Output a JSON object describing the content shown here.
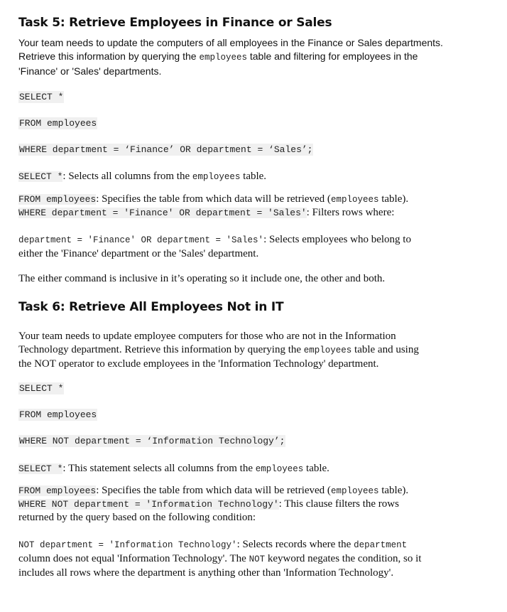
{
  "task5": {
    "heading": "Task 5: Retrieve Employees in Finance or Sales",
    "intro": {
      "p1": "Your team needs to update the computers of all employees in the Finance or Sales departments.",
      "p2a": "Retrieve this information by querying the ",
      "p2code": "employees",
      "p2b": " table and filtering for employees in the",
      "p3": "'Finance' or 'Sales' departments."
    },
    "code": {
      "line1": "SELECT *",
      "line2": "FROM employees",
      "line3": "WHERE department = ‘Finance’ OR department = ‘Sales’;"
    },
    "explain": {
      "select_code": "SELECT *",
      "select_text": ": Selects all columns from the ",
      "select_tbl": "employees",
      "select_end": " table.",
      "from_code": "FROM employees",
      "from_text": ": Specifies the table from which data will be retrieved (",
      "from_tbl": "employees",
      "from_end": " table).",
      "where_code": "WHERE department = 'Finance' OR department = 'Sales'",
      "where_text": ": Filters rows where:",
      "cond_code": "department = 'Finance' OR department = 'Sales'",
      "cond_text": ": Selects employees who belong to",
      "cond_text2": "either the 'Finance' department or the 'Sales' department."
    },
    "note": "The either command is inclusive in it’s operating so it include one, the other and both."
  },
  "task6": {
    "heading": "Task 6: Retrieve All Employees Not in IT",
    "intro": {
      "p1": "Your team needs to update employee computers for those who are not in the Information",
      "p2a": "Technology department. Retrieve this information by querying the ",
      "p2code": "employees",
      "p2b": " table and using",
      "p3": "the NOT operator to exclude employees in the 'Information Technology' department."
    },
    "code": {
      "line1": "SELECT *",
      "line2": "FROM employees",
      "line3": "WHERE NOT department = ‘Information Technology’;"
    },
    "explain": {
      "select_code": "SELECT *",
      "select_text": ": This statement selects all columns from the ",
      "select_tbl": "employees",
      "select_end": " table.",
      "from_code": "FROM employees",
      "from_text": ": Specifies the table from which data will be retrieved (",
      "from_tbl": "employees",
      "from_end": " table).",
      "where_code": "WHERE NOT department = 'Information Technology'",
      "where_text": ": This clause filters the rows",
      "where_text2": "returned by the query based on the following condition:",
      "cond_code": "NOT department = 'Information Technology'",
      "cond_text": ": Selects records where the ",
      "cond_field": "department",
      "cond_text2": "column does not equal 'Information Technology'. The ",
      "cond_not": "NOT",
      "cond_text3": " keyword negates the condition, so it",
      "cond_text4": "includes all rows where the department is anything other than 'Information Technology'."
    }
  }
}
